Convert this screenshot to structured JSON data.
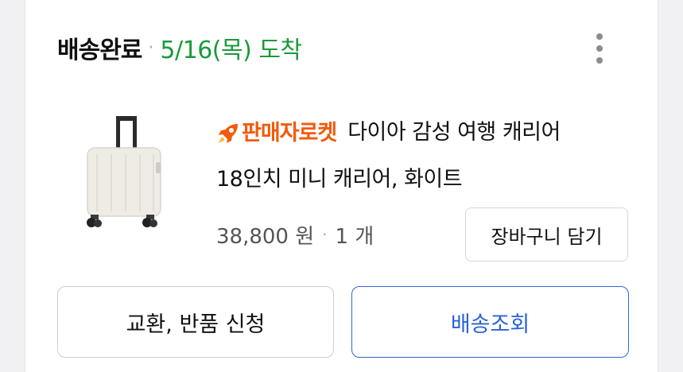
{
  "order": {
    "status": "배송완료",
    "separator": "·",
    "arrival": "5/16(목) 도착"
  },
  "product": {
    "badge_label": "판매자로켓",
    "title_line1": "다이아 감성 여행 캐리어",
    "title_line2": "18인치 미니 캐리어, 화이트",
    "price": "38,800 원",
    "separator": "·",
    "quantity": "1 개"
  },
  "actions": {
    "add_to_cart": "장바구니 담기",
    "exchange_return": "교환, 반품 신청",
    "track_delivery": "배송조회"
  },
  "icons": {
    "more": "more-vertical-icon",
    "badge": "rocket-icon"
  },
  "colors": {
    "status_text": "#111111",
    "arrival_green": "#1a9a3b",
    "badge_orange": "#f25a0c",
    "track_blue": "#2962d9"
  }
}
